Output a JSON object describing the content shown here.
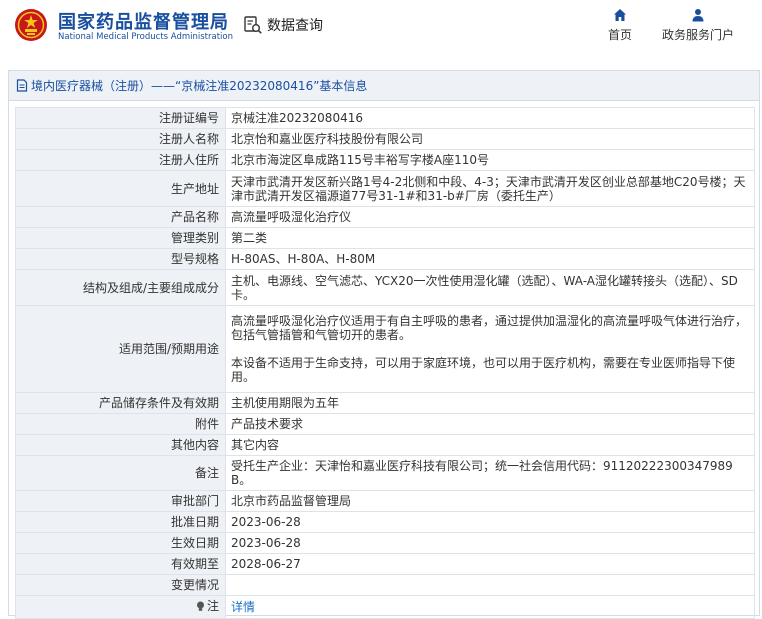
{
  "header": {
    "brand_cn": "国家药品监督管理局",
    "brand_en": "National Medical Products Administration",
    "query_label": "数据查询",
    "nav": [
      {
        "label": "首页",
        "icon": "home-icon"
      },
      {
        "label": "政务服务门户",
        "icon": "user-icon"
      }
    ]
  },
  "panel": {
    "title": "境内医疗器械（注册）——“京械注准20232080416”基本信息"
  },
  "rows": [
    {
      "label": "注册证编号",
      "value": "京械注准20232080416"
    },
    {
      "label": "注册人名称",
      "value": "北京怡和嘉业医疗科技股份有限公司"
    },
    {
      "label": "注册人住所",
      "value": "北京市海淀区阜成路115号丰裕写字楼A座110号"
    },
    {
      "label": "生产地址",
      "value": "天津市武清开发区新兴路1号4-2北侧和中段、4-3；天津市武清开发区创业总部基地C20号楼；天津市武清开发区福源道77号31-1#和31-b#厂房（委托生产）"
    },
    {
      "label": "产品名称",
      "value": "高流量呼吸湿化治疗仪"
    },
    {
      "label": "管理类别",
      "value": "第二类"
    },
    {
      "label": "型号规格",
      "value": "H-80AS、H-80A、H-80M"
    },
    {
      "label": "结构及组成/主要组成成分",
      "value": "主机、电源线、空气滤芯、YCX20一次性使用湿化罐（选配）、WA-A湿化罐转接头（选配）、SD卡。"
    },
    {
      "label": "适用范围/预期用途",
      "paragraphs": [
        "高流量呼吸湿化治疗仪适用于有自主呼吸的患者，通过提供加温湿化的高流量呼吸气体进行治疗，包括气管插管和气管切开的患者。",
        "本设备不适用于生命支持，可以用于家庭环境，也可以用于医疗机构，需要在专业医师指导下使用。"
      ]
    },
    {
      "label": "产品储存条件及有效期",
      "value": "主机使用期限为五年"
    },
    {
      "label": "附件",
      "value": "产品技术要求"
    },
    {
      "label": "其他内容",
      "value": "其它内容"
    },
    {
      "label": "备注",
      "value": "受托生产企业：天津怡和嘉业医疗科技有限公司；统一社会信用代码：91120222300347989B。"
    },
    {
      "label": "审批部门",
      "value": "北京市药品监督管理局"
    },
    {
      "label": "批准日期",
      "value": "2023-06-28"
    },
    {
      "label": "生效日期",
      "value": "2023-06-28"
    },
    {
      "label": "有效期至",
      "value": "2028-06-27"
    },
    {
      "label": "变更情况",
      "value": ""
    },
    {
      "label": "注",
      "value": "详情",
      "icon": "lightbulb-icon"
    }
  ]
}
